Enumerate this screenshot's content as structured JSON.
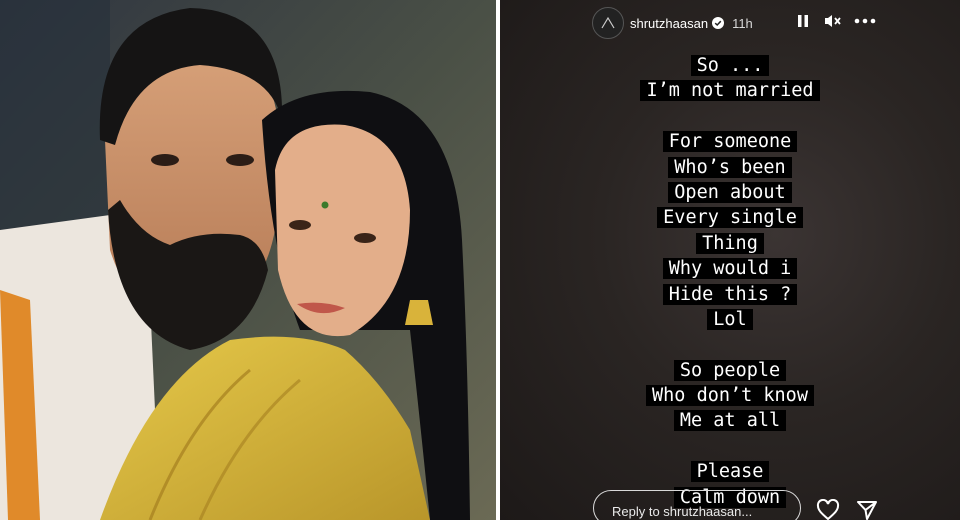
{
  "story": {
    "username": "shrutzhaasan",
    "time": "11h",
    "lines": [
      "So ...",
      "I’m not married",
      "",
      "For someone",
      "Who’s been",
      "Open about",
      "Every single",
      "Thing",
      "Why would i",
      "Hide this ?",
      "Lol",
      "",
      "So people",
      "Who don’t know",
      "Me at all",
      "",
      "Please",
      "Calm down"
    ],
    "reply_placeholder": "Reply to shrutzhaasan..."
  },
  "icons": [
    "pause-icon",
    "mute-icon",
    "more-icon",
    "heart-icon",
    "send-icon",
    "verified-icon",
    "avatar-icon"
  ]
}
